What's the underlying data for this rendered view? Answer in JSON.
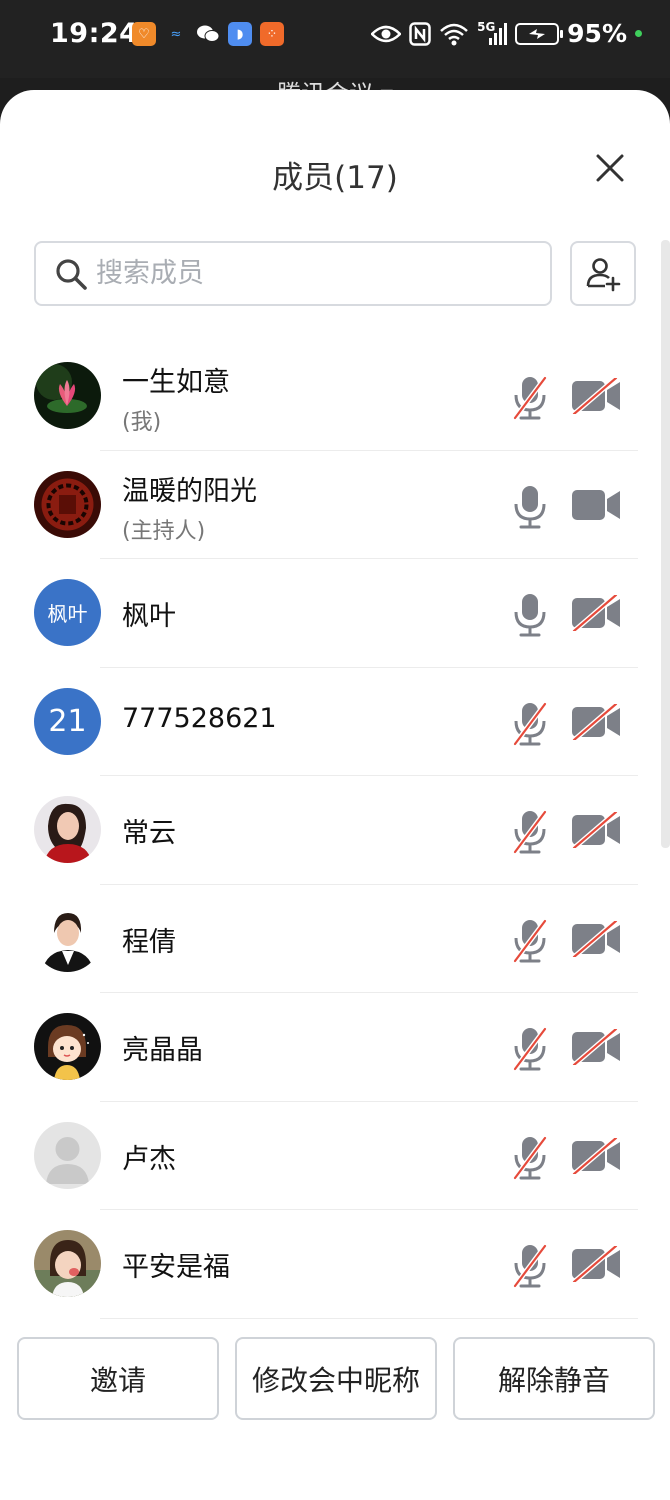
{
  "status_bar": {
    "time": "19:24",
    "network": "5G",
    "battery": "95%",
    "icons": [
      "shield-app-icon",
      "cloud-app-icon",
      "wechat-icon",
      "browser-app-icon",
      "app-grid-icon",
      "eye-icon",
      "nfc-icon",
      "wifi-icon",
      "signal-icon",
      "battery-icon"
    ]
  },
  "background_title": "腾讯会议 ▾",
  "panel": {
    "title": "成员(17)",
    "search_placeholder": "搜索成员"
  },
  "members": [
    {
      "name": "一生如意",
      "sub": "(我)",
      "avatar": "lotus-photo",
      "mic_muted": true,
      "camera_off": true
    },
    {
      "name": "温暖的阳光",
      "sub": "(主持人)",
      "avatar": "red-seal-photo",
      "mic_muted": false,
      "camera_off": false
    },
    {
      "name": "枫叶",
      "sub": "",
      "avatar_text": "枫叶",
      "avatar_color": "#3a73c7",
      "mic_muted": false,
      "camera_off": true
    },
    {
      "name": "777528621",
      "sub": "",
      "avatar_text": "21",
      "avatar_color": "#3a73c7",
      "mic_muted": true,
      "camera_off": true
    },
    {
      "name": "常云",
      "sub": "",
      "avatar": "woman-photo",
      "mic_muted": true,
      "camera_off": true
    },
    {
      "name": "程倩",
      "sub": "",
      "avatar": "woman-suit-photo",
      "mic_muted": true,
      "camera_off": true
    },
    {
      "name": "亮晶晶",
      "sub": "",
      "avatar": "cartoon-girl",
      "mic_muted": true,
      "camera_off": true
    },
    {
      "name": "卢杰",
      "sub": "",
      "avatar": "default-person",
      "mic_muted": true,
      "camera_off": true
    },
    {
      "name": "平安是福",
      "sub": "",
      "avatar": "child-photo",
      "mic_muted": true,
      "camera_off": true
    }
  ],
  "buttons": {
    "invite": "邀请",
    "rename": "修改会中昵称",
    "unmute": "解除静音"
  },
  "colors": {
    "icon_gray": "#7d8088",
    "strike_red": "#e64a3b",
    "accent_blue": "#3a73c7"
  }
}
